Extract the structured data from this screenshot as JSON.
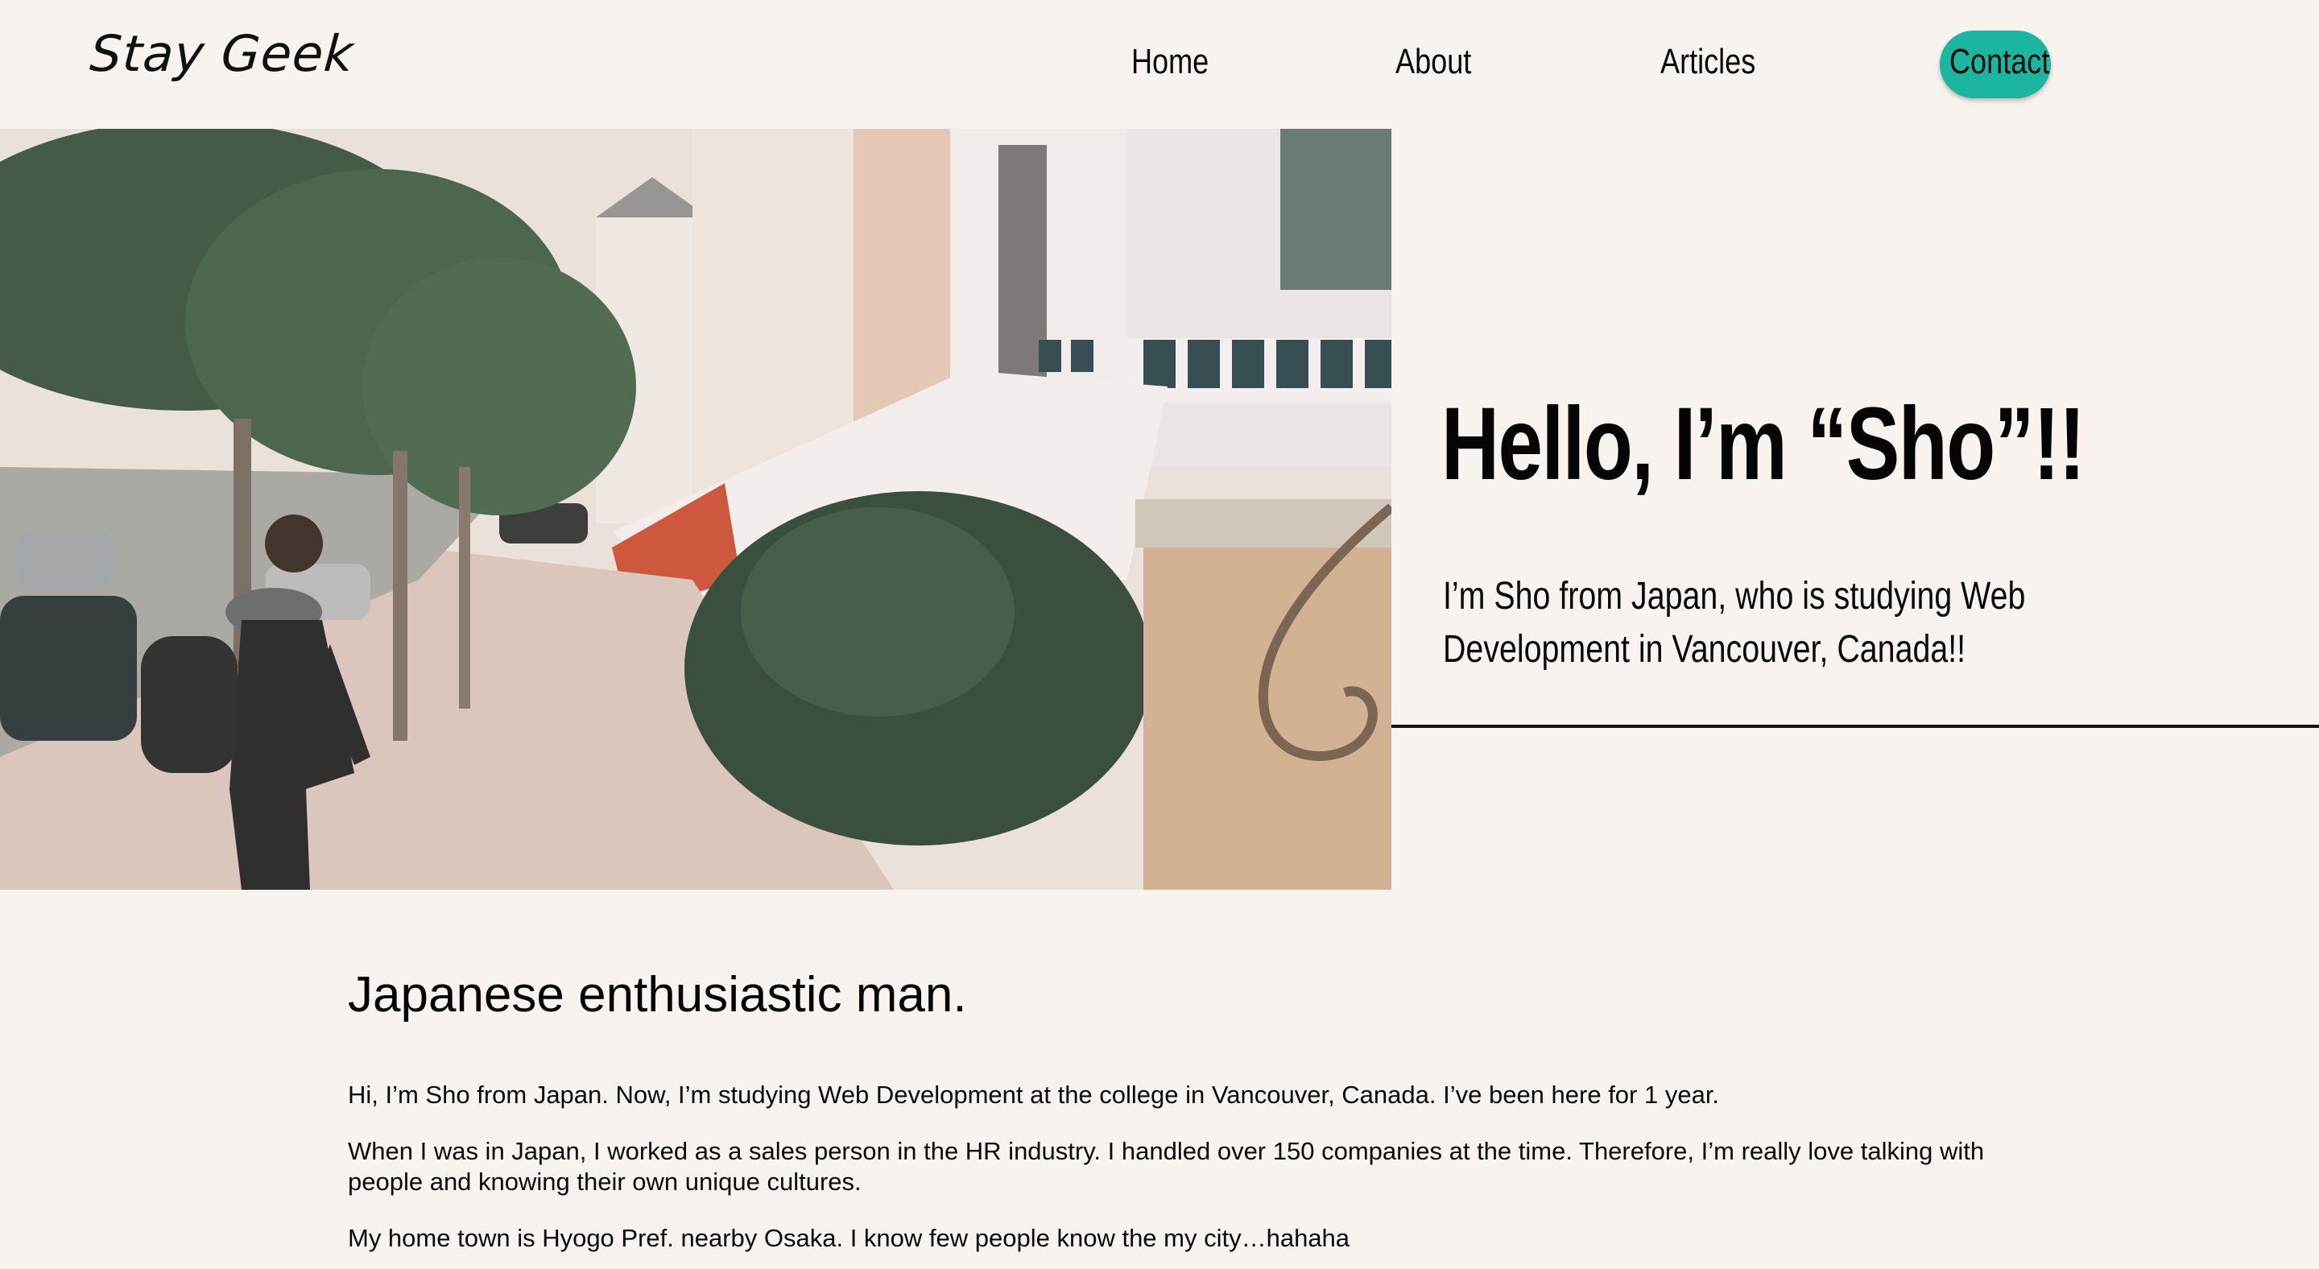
{
  "header": {
    "logo": "Stay Geek",
    "nav": [
      {
        "label": "Home"
      },
      {
        "label": "About"
      },
      {
        "label": "Articles"
      },
      {
        "label": "Contact"
      }
    ],
    "contact_color": "#1bb5a0"
  },
  "hero": {
    "title": "Hello, I’m “Sho”!!",
    "subtitle": "I’m Sho from Japan, who is studying Web Development in Vancouver, Canada!!"
  },
  "article": {
    "heading": "Japanese enthusiastic man.",
    "paragraphs": [
      "Hi, I’m Sho from Japan. Now, I’m studying Web Development at the college in Vancouver, Canada. I’ve been here for 1 year.",
      "When I was in Japan, I worked as a sales person in the HR industry. I handled over 150 companies at the time. Therefore, I’m really love talking with people and knowing their own unique cultures.",
      "My home town is Hyogo Pref. nearby Osaka. I know few people know the my city…hahaha"
    ]
  },
  "colors": {
    "background": "#f8f3ef",
    "text": "#111111"
  }
}
